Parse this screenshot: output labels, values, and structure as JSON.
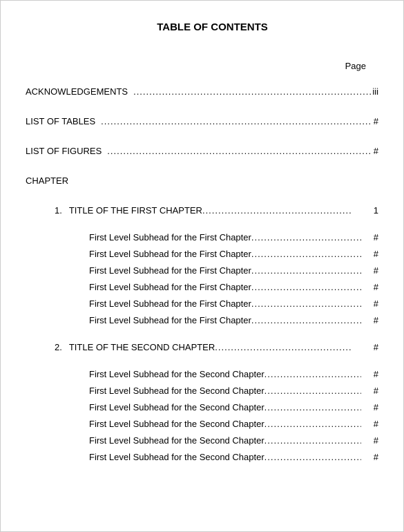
{
  "title": "TABLE OF CONTENTS",
  "page_label": "Page",
  "front": {
    "ack_label": "ACKNOWLEDGEMENTS",
    "ack_page": "iii",
    "lot_label": "LIST OF TABLES",
    "lot_page": "#",
    "lof_label": "LIST OF FIGURES",
    "lof_page": "#"
  },
  "chapter_heading": "CHAPTER",
  "chapters": [
    {
      "num": "1.",
      "title": "TITLE OF THE FIRST CHAPTER",
      "page": "1",
      "subs": [
        {
          "label": "First Level Subhead for the First Chapter",
          "page": "#"
        },
        {
          "label": "First Level Subhead for the First Chapter",
          "page": "#"
        },
        {
          "label": "First Level Subhead for the First Chapter",
          "page": "#"
        },
        {
          "label": "First Level Subhead for the First Chapter",
          "page": "#"
        },
        {
          "label": "First Level Subhead for the First Chapter",
          "page": "#"
        },
        {
          "label": "First Level Subhead for the First Chapter",
          "page": "#"
        }
      ]
    },
    {
      "num": "2.",
      "title": "TITLE OF THE SECOND CHAPTER",
      "page": "#",
      "subs": [
        {
          "label": "First Level Subhead for the Second Chapter",
          "page": "#"
        },
        {
          "label": "First Level Subhead for the Second Chapter",
          "page": "#"
        },
        {
          "label": "First Level Subhead for the Second Chapter",
          "page": "#"
        },
        {
          "label": "First Level Subhead for the Second Chapter",
          "page": "#"
        },
        {
          "label": "First Level Subhead for the Second Chapter",
          "page": "#"
        },
        {
          "label": "First Level Subhead for the Second Chapter",
          "page": "#"
        }
      ]
    }
  ]
}
